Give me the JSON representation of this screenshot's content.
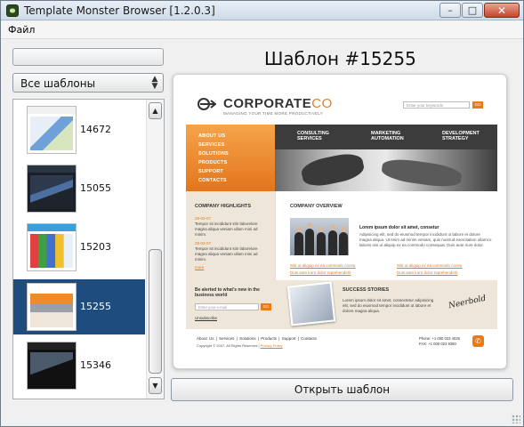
{
  "window": {
    "title": "Template Monster Browser [1.2.0.3]",
    "minimize_glyph": "–",
    "maximize_glyph": "□",
    "close_glyph": "✕"
  },
  "menu": {
    "items": [
      {
        "label": "Файл"
      }
    ]
  },
  "sidebar": {
    "search_value": "",
    "filter": {
      "selected": "Все шаблоны"
    },
    "templates": [
      {
        "id": "14672",
        "selected": false
      },
      {
        "id": "15055",
        "selected": false
      },
      {
        "id": "15203",
        "selected": false
      },
      {
        "id": "15255",
        "selected": true
      },
      {
        "id": "15346",
        "selected": false
      }
    ]
  },
  "main": {
    "title": "Шаблон #15255",
    "open_button_label": "Открыть шаблон"
  },
  "preview": {
    "logo_main": "CORPORATE",
    "logo_accent": "CO",
    "tagline": "MANAGING YOUR TIME MORE PRODUCTIVELY",
    "search_placeholder": "Enter your keywords",
    "search_go": "GO",
    "nav": [
      "ABOUT US",
      "SERVICES",
      "SOLUTIONS",
      "PRODUCTS",
      "SUPPORT",
      "CONTACTS"
    ],
    "tabs": [
      {
        "line1": "CONSULTING",
        "line2": "SERVICES"
      },
      {
        "line1": "MARKETING",
        "line2": "AUTOMATION"
      },
      {
        "line1": "DEVELOPMENT",
        "line2": "STRATEGY"
      }
    ],
    "highlights_heading": "COMPANY HIGHLIGHTS",
    "highlight_1_date": "28-03-07",
    "highlight_1_text": "Tempor sit incididunt stin laborelore magna aliqua veniam ullam mini ad minim.",
    "highlight_2_date": "28-03-07",
    "highlight_2_text": "Tempor sit incididunt stin laborelore magna aliqua veniam ullam mini ad minim.",
    "more_link": "more",
    "overview_heading": "COMPANY OVERVIEW",
    "overview_intro_heading": "Lorem ipsum dolor sit amet, consetur",
    "overview_intro_text": "Adipisicing elit, sed do eiusmod tempor incididunt ut labore et dolore magna aliqua. Ut enim ad minim veniam, quis nostrud exercitation ullamco laboris nisi ut aliquip ex ea commodo consequat. Duis aute irure dolor.",
    "overview_links": [
      "Sitit ut aliquip ex ea commodo conse",
      "Duis aute irure dolor reprehenderit",
      "Sitit ut aliquip ex ea commodo conse",
      "Duis aute irure dolor reprehenderit"
    ],
    "newsletter_heading": "Be alerted to what's new in the business world",
    "newsletter_placeholder": "Enter your e-mail",
    "newsletter_go": "GO",
    "unsubscribe": "Unsubscribe",
    "success_heading": "SUCCESS STORIES",
    "success_text": "Lorem ipsum dolor sit amet, consectetur adipisicing elit, sed do eiusmod tempor incididunt ut labore et dolore magna aliqua.",
    "signature": "Neerbold",
    "footer_links": "About Us  |  Services  |  Solutions  |  Products  |  Support  |  Contacts",
    "footer_copy": "Copyright © 2007. All Rights Reserved",
    "footer_privacy": "Privacy Policy",
    "footer_phone": "Phone:   +1 000 023 4025",
    "footer_fax": "FAX:       +1 000 023 9350",
    "phone_icon_glyph": "✆"
  },
  "colors": {
    "selection": "#1f4c7e",
    "accent_orange": "#e87a1a",
    "site_beige": "#eee7d9"
  }
}
